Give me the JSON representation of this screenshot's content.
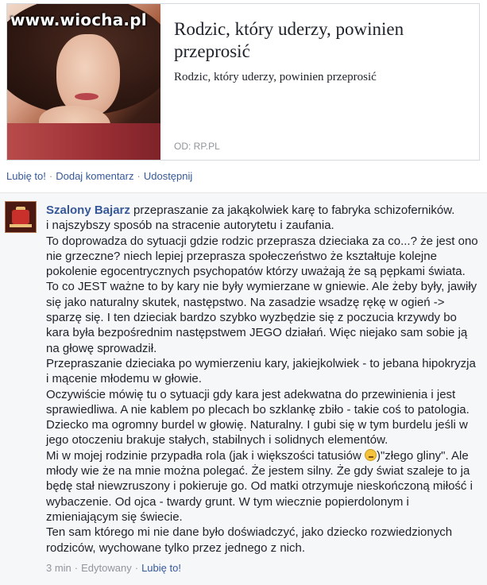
{
  "link_card": {
    "watermark": "www.wiocha.pl",
    "title": "Rodzic, który uderzy, powinien przeprosić",
    "description": "Rodzic, który uderzy, powinien przeprosić",
    "source": "OD: RP.PL"
  },
  "actions": {
    "like": "Lubię to!",
    "comment": "Dodaj komentarz",
    "share": "Udostępnij",
    "separator": "·"
  },
  "comment": {
    "author": "Szalony Bajarz",
    "lines": [
      "przepraszanie za jakąkolwiek karę to fabryka schizoferników.",
      "i najszybszy sposób na stracenie autorytetu i zaufania.",
      "To doprowadza do sytuacji gdzie rodzic przeprasza dzieciaka za co...? że jest ono nie grzeczne? niech lepiej przeprasza społeczeństwo że kształtuje kolejne pokolenie egocentrycznych psychopatów którzy uważają że są pępkami świata.",
      "To co JEST ważne to by kary nie były wymierzane w gniewie. Ale żeby były, jawiły się jako naturalny skutek, następstwo. Na zasadzie wsadzę rękę w ogień -> sparzę się. I ten dzieciak bardzo szybko wyzbędzie się z poczucia krzywdy bo kara była bezpośrednim następstwem JEGO działań. Więc niejako sam sobie ją na głowę sprowadził.",
      "Przepraszanie dzieciaka po wymierzeniu kary, jakiejkolwiek - to jebana hipokryzja i mącenie młodemu w głowie.",
      "Oczywiście mówię tu o sytuacji gdy kara jest adekwatna do przewinienia i jest sprawiedliwa. A nie kablem po plecach bo szklankę zbiło - takie coś to patologia.",
      "Dziecko ma ogromny burdel w głowię. Naturalny. I gubi się w tym burdelu jeśli w jego otoczeniu brakuje stałych, stabilnych i solidnych elementów.",
      "Mi w mojej rodzinie przypadła rola (jak i większości tatusiów ",
      ")\"złego gliny\". Ale młody wie że na mnie można polegać. Że jestem silny. Że gdy świat szaleje to ja będę stał niewzruszony i pokieruje go. Od matki otrzymuje nieskończoną miłość i wybaczenie. Od ojca - twardy grunt. W tym wiecznie popierdolonym i zmieniającym się świecie.",
      "Ten sam którego mi nie dane było doświadczyć, jako dziecko rozwiedzionych rodziców, wychowane tylko przez jednego z nich."
    ],
    "emoji_icon": "grimace-emoji-icon",
    "meta": {
      "time": "3 min",
      "edited": "Edytowany",
      "like": "Lubię to!",
      "separator": "·"
    }
  },
  "colors": {
    "link_blue": "#365899",
    "comment_bg": "#f6f7f9",
    "muted_text": "#90949c"
  }
}
